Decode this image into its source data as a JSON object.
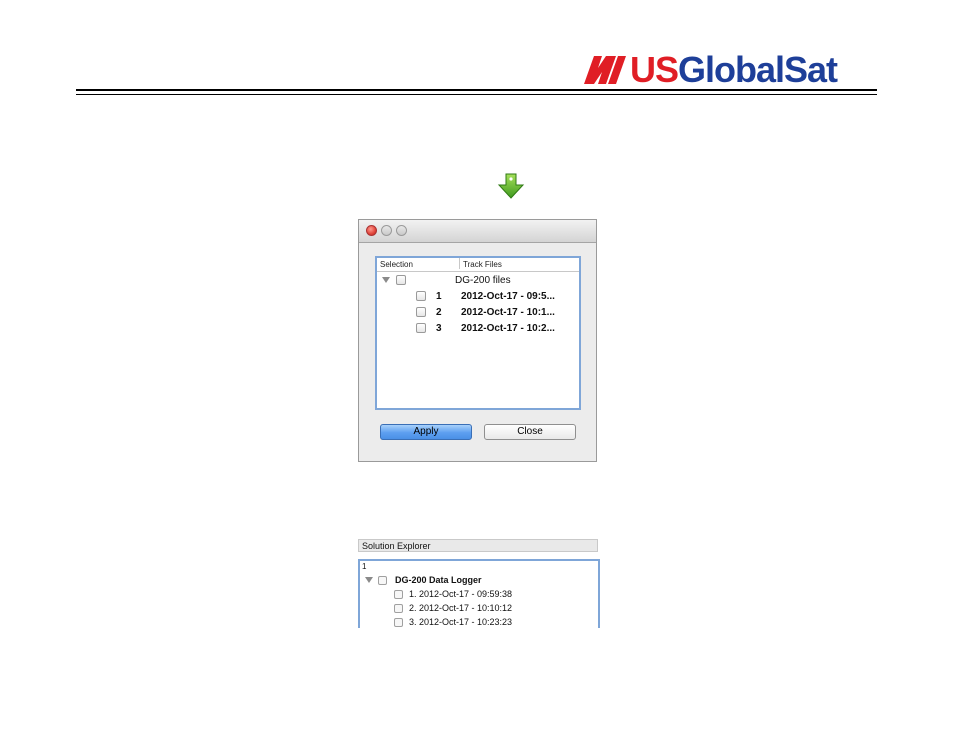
{
  "header": {
    "logo_us": "US",
    "logo_global": "GlobalSat",
    "brand_red": "#e01e25",
    "brand_blue": "#1e3f99"
  },
  "download_icon": "download-arrow-icon",
  "dialog": {
    "col_selection": "Selection",
    "col_track_files": "Track Files",
    "root_label": "DG-200 files",
    "files": [
      {
        "num": "1",
        "name": "2012-Oct-17 - 09:5..."
      },
      {
        "num": "2",
        "name": "2012-Oct-17 - 10:1..."
      },
      {
        "num": "3",
        "name": "2012-Oct-17 - 10:2..."
      }
    ],
    "apply_label": "Apply",
    "close_label": "Close"
  },
  "solution_explorer": {
    "title": "Solution Explorer",
    "sub": "1",
    "root_label": "DG-200 Data Logger",
    "items": [
      "1. 2012-Oct-17 - 09:59:38",
      "2. 2012-Oct-17 - 10:10:12",
      "3. 2012-Oct-17 - 10:23:23"
    ]
  }
}
